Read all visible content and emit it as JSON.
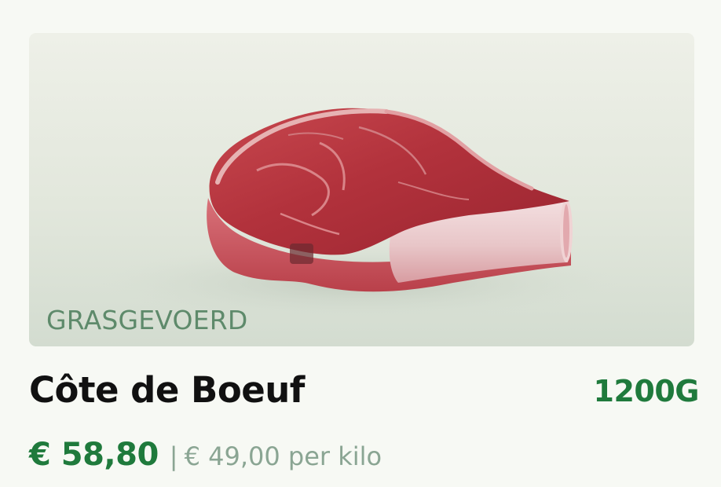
{
  "product": {
    "image_name": "cote-de-boeuf-steak",
    "tag": "GRASGEVOERD",
    "title": "Côte de Boeuf",
    "weight": "1200G",
    "price": "€ 58,80",
    "separator": "|",
    "unit_price": "€ 49,00 per kilo"
  },
  "colors": {
    "accent_green": "#1f7a3c",
    "muted_green": "#8aa593",
    "tag_green": "#5e8a6b",
    "title": "#111111"
  }
}
